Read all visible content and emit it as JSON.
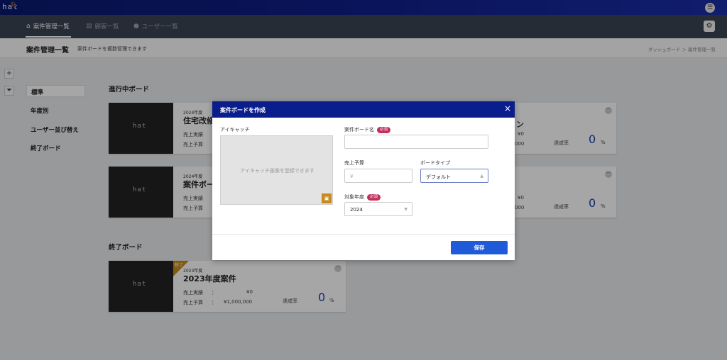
{
  "app": {
    "logo": "hat"
  },
  "nav": {
    "items": [
      {
        "label": "案件管理一覧",
        "icon": "home-icon"
      },
      {
        "label": "顧客一覧",
        "icon": "document-icon"
      },
      {
        "label": "ユーザー一覧",
        "icon": "user-icon"
      }
    ]
  },
  "header": {
    "title": "案件管理一覧",
    "subtitle": "案件ボードを複数管理できます",
    "breadcrumb": "ダッシュボード ＞ 案件管理一覧"
  },
  "sidebar": {
    "items": [
      "標準",
      "年度別",
      "ユーザー並び替え",
      "終了ボード"
    ],
    "active": "標準"
  },
  "sections": {
    "active": "進行中ボード",
    "ended": "終了ボード"
  },
  "cards": [
    {
      "year": "2024年度",
      "name": "住宅改修",
      "actual_label": "売上実績",
      "budget_label": "売上予算"
    },
    {
      "year": "2024年度",
      "name": "案件ボー",
      "actual_label": "売上実績",
      "budget_label": "売上予算"
    },
    {
      "year": "2023年度",
      "name": "2023年度案件",
      "actual_label": "売上実績",
      "budget_label": "売上予算",
      "sep": "：",
      "actual": "¥0",
      "budget": "¥1,000,000",
      "rate_label": "達成率",
      "rate": "0",
      "rate_unit": "%",
      "ribbon": "終了"
    }
  ],
  "right_cards": [
    {
      "actual": "¥0",
      "budget": "000",
      "rate_label": "達成率",
      "rate": "0",
      "rate_unit": "%",
      "name_tail": "ン"
    },
    {
      "actual": "¥0",
      "budget": "000",
      "rate_label": "達成率",
      "rate": "0",
      "rate_unit": "%"
    }
  ],
  "modal": {
    "title": "案件ボードを作成",
    "close": "×",
    "eyecatch_label": "アイキャッチ",
    "eyecatch_placeholder": "アイキャッチ画像を登録できます",
    "name_label": "案件ボード名",
    "required": "必須",
    "budget_label": "売上予算",
    "budget_prefix": "¥",
    "board_type_label": "ボードタイプ",
    "board_type_value": "デフォルト",
    "year_label": "対象年度",
    "year_value": "2024",
    "save": "保存"
  },
  "colors": {
    "topbar": "#0f1f8a",
    "navbar": "#3b4454",
    "modal_header": "#0a1d8c",
    "primary_button": "#1f5ad8",
    "required_badge": "#c0305a",
    "accent_gold": "#c88a1a",
    "rate_number": "#1a3fb0"
  }
}
